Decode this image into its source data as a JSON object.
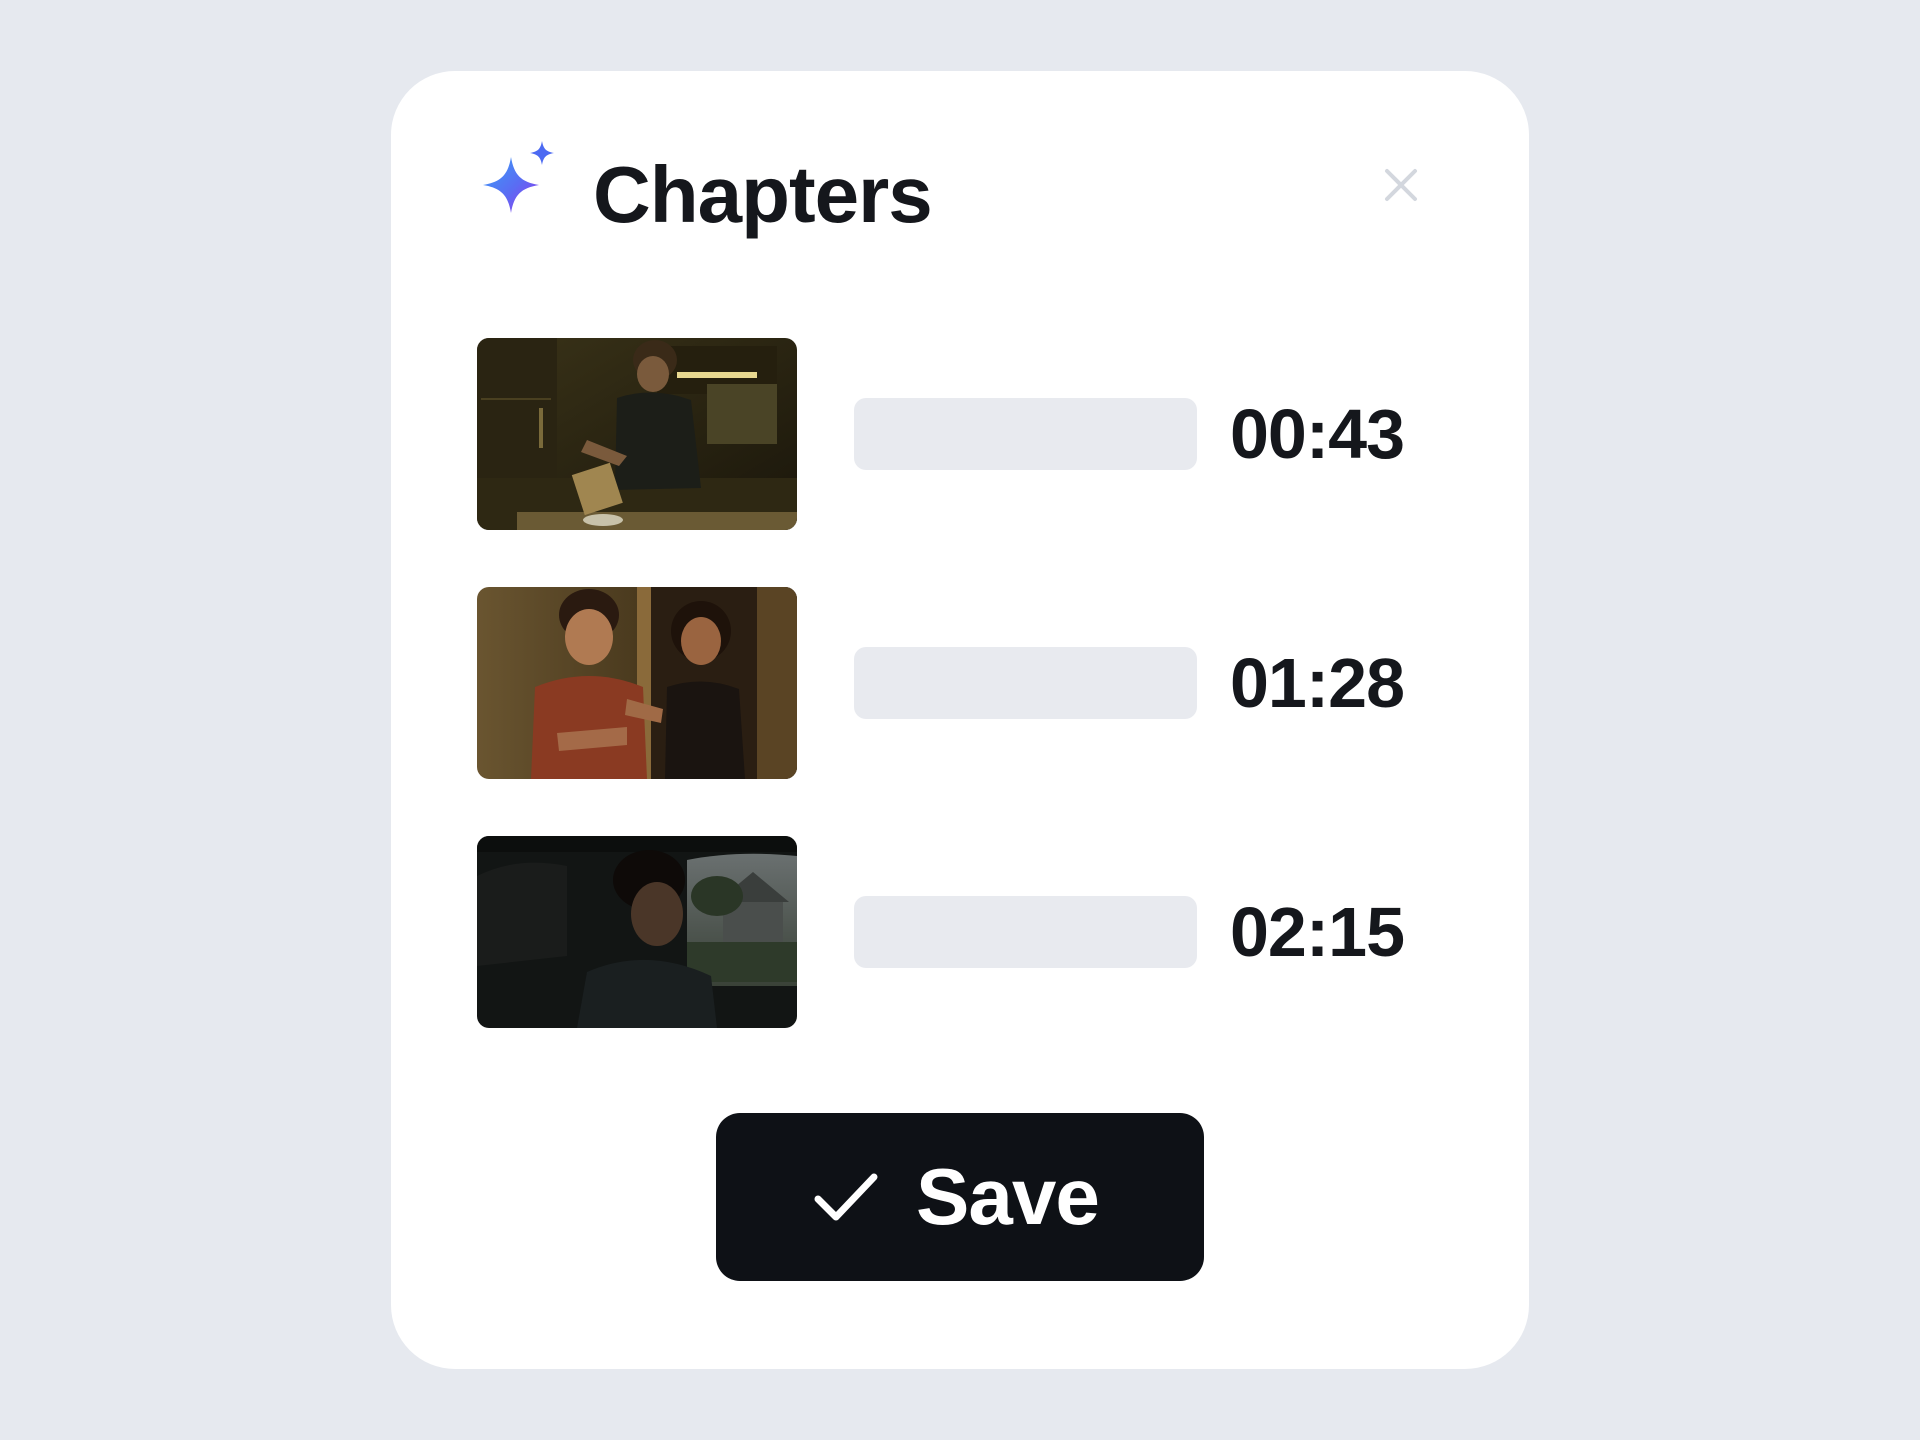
{
  "dialog": {
    "title": "Chapters",
    "icons": {
      "header": "sparkle-icon",
      "close": "close-icon",
      "save": "checkmark-icon"
    },
    "colors": {
      "background": "#e6e9ef",
      "card": "#ffffff",
      "field": "#e8eaef",
      "button": "#0e1116",
      "sparkle_gradient": [
        "#4f7df5",
        "#8b3bf0"
      ]
    }
  },
  "chapters": [
    {
      "thumbnail": "man-pouring-cereal-in-dark-kitchen",
      "name": "",
      "time": "00:43"
    },
    {
      "thumbnail": "couple-talking-in-doorway",
      "name": "",
      "time": "01:28"
    },
    {
      "thumbnail": "young-man-in-car-at-dusk",
      "name": "",
      "time": "02:15"
    }
  ],
  "save_button": {
    "label": "Save"
  }
}
